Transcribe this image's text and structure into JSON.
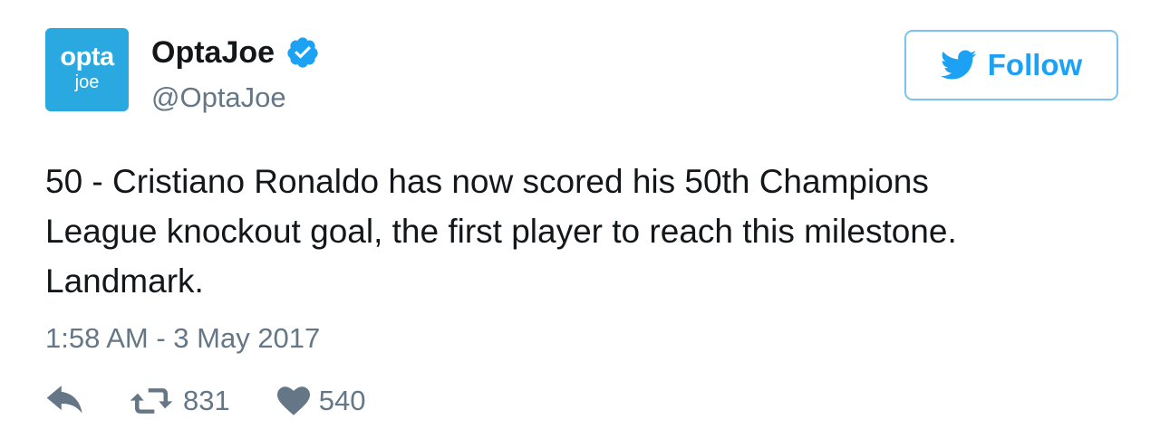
{
  "account": {
    "avatar_line1": "opta",
    "avatar_line2": "joe",
    "display_name": "OptaJoe",
    "handle": "@OptaJoe",
    "verified": true
  },
  "follow_button": {
    "label": "Follow",
    "icon": "twitter-bird-icon"
  },
  "tweet": {
    "lines": [
      "50 - Cristiano Ronaldo has now scored his 50th Champions",
      "League knockout goal, the first player to reach this milestone.",
      "Landmark."
    ],
    "timestamp": "1:58 AM - 3 May 2017"
  },
  "actions": {
    "reply_icon": "reply-icon",
    "retweet_icon": "retweet-icon",
    "retweet_count": "831",
    "like_icon": "heart-icon",
    "like_count": "540"
  },
  "colors": {
    "brand_blue": "#1da1f2",
    "avatar_bg": "#2aa9e0",
    "muted_text": "#657786",
    "body_text": "#14171a"
  }
}
